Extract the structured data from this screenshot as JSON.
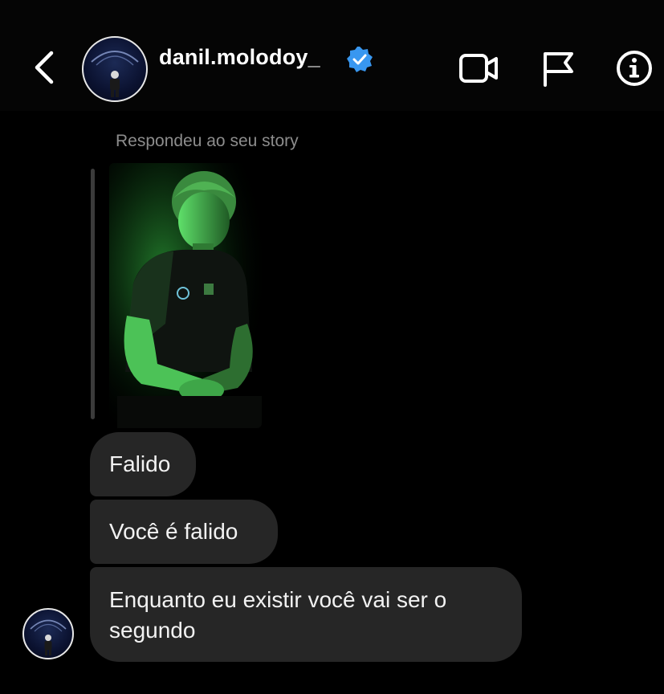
{
  "header": {
    "username": "danil.molodoy_",
    "verified": true,
    "icons": {
      "back": "chevron-left-icon",
      "video": "video-call-icon",
      "flag": "flag-icon",
      "info": "info-icon",
      "verified": "verified-badge-icon"
    }
  },
  "conversation": {
    "story_reply_label": "Respondeu ao seu story",
    "messages": [
      {
        "text": "Falido"
      },
      {
        "text": "Você é falido"
      },
      {
        "text": "Enquanto eu existir você vai ser o segundo"
      }
    ]
  },
  "colors": {
    "background": "#000000",
    "bubble": "#262626",
    "muted_text": "#8d8d8d",
    "verified_blue": "#3897f0",
    "story_glow": "#3bd14a"
  }
}
